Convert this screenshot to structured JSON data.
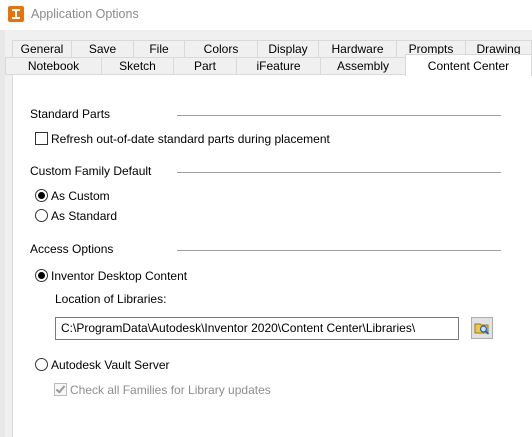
{
  "window": {
    "title": "Application Options"
  },
  "tabs_row1": [
    "General",
    "Save",
    "File",
    "Colors",
    "Display",
    "Hardware",
    "Prompts",
    "Drawing"
  ],
  "tabs_row2": [
    "Notebook",
    "Sketch",
    "Part",
    "iFeature",
    "Assembly",
    "Content Center"
  ],
  "active_tab": "Content Center",
  "standard_parts": {
    "heading": "Standard Parts",
    "refresh_label": "Refresh out-of-date standard parts during placement",
    "refresh_checked": false
  },
  "custom_family": {
    "heading": "Custom Family Default",
    "as_custom_label": "As Custom",
    "as_standard_label": "As Standard",
    "selected": "As Custom"
  },
  "access_options": {
    "heading": "Access Options",
    "desktop_label": "Inventor Desktop Content",
    "desktop_selected": true,
    "location_label": "Location of Libraries:",
    "location_value": "C:\\ProgramData\\Autodesk\\Inventor 2020\\Content Center\\Libraries\\",
    "browse_icon": "browse-folder-icon",
    "vault_label": "Autodesk Vault Server",
    "vault_selected": false,
    "check_families_label": "Check all Families for Library updates",
    "check_families_checked": true,
    "check_families_enabled": false
  },
  "colors": {
    "accent": "#0078d7",
    "icon_orange": "#e8730c",
    "folder_yellow": "#f3c63f"
  }
}
